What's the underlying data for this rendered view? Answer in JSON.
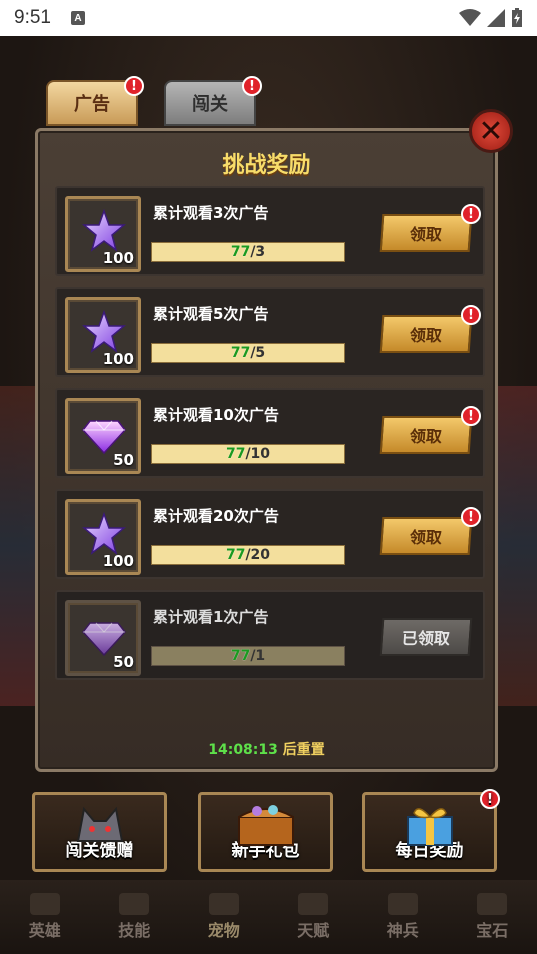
{
  "status_bar": {
    "time": "9:51",
    "notification_icon": "A"
  },
  "tabs": [
    {
      "label": "广告",
      "active": true,
      "alert": "!"
    },
    {
      "label": "闯关",
      "active": false,
      "alert": "!"
    }
  ],
  "panel": {
    "title": "挑战奖励",
    "close_label": "✕",
    "rewards": [
      {
        "title": "累计观看3次广告",
        "item": "star-icon",
        "count": "100",
        "progress_current": "77",
        "progress_total": "/3",
        "button": "领取",
        "claimed": false,
        "alert": "!"
      },
      {
        "title": "累计观看5次广告",
        "item": "star-icon",
        "count": "100",
        "progress_current": "77",
        "progress_total": "/5",
        "button": "领取",
        "claimed": false,
        "alert": "!"
      },
      {
        "title": "累计观看10次广告",
        "item": "diamond-icon",
        "count": "50",
        "progress_current": "77",
        "progress_total": "/10",
        "button": "领取",
        "claimed": false,
        "alert": "!"
      },
      {
        "title": "累计观看20次广告",
        "item": "star-icon",
        "count": "100",
        "progress_current": "77",
        "progress_total": "/20",
        "button": "领取",
        "claimed": false,
        "alert": "!"
      },
      {
        "title": "累计观看1次广告",
        "item": "diamond-icon",
        "count": "50",
        "progress_current": "77",
        "progress_total": "/1",
        "button": "已领取",
        "claimed": true,
        "alert": ""
      }
    ],
    "reset_time": "14:08:13",
    "reset_suffix": "后重置"
  },
  "features": [
    {
      "label": "闯关馈赠",
      "alert": ""
    },
    {
      "label": "新手礼包",
      "alert": ""
    },
    {
      "label": "每日奖励",
      "alert": "!"
    }
  ],
  "bottom_nav": [
    {
      "label": "英雄"
    },
    {
      "label": "技能"
    },
    {
      "label": "宠物"
    },
    {
      "label": "天赋"
    },
    {
      "label": "神兵"
    },
    {
      "label": "宝石"
    }
  ],
  "colors": {
    "title": "#f8dd6a",
    "progress_current": "#1a9a20",
    "reset_time": "#5ee04a",
    "alert": "#e0222a",
    "claim_button": "#f3c86a"
  }
}
